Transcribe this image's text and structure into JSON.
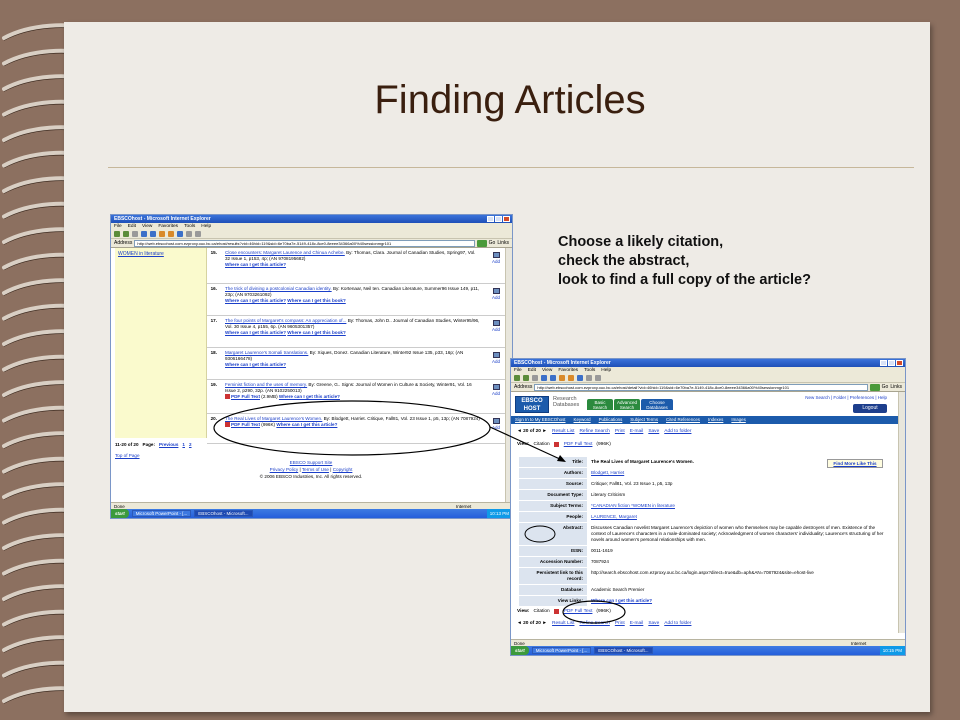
{
  "slide": {
    "title": "Finding Articles",
    "instructions": [
      "Choose a likely citation,",
      "check the abstract,",
      "look to find a full copy of the article?"
    ],
    "colors": {
      "background": "#8c7060",
      "paper": "#eeebe6",
      "title": "#3a1f0f",
      "rule": "#c6b79a",
      "annotation": "#000000"
    }
  },
  "results_window": {
    "title": "EBSCOhost - Microsoft Internet Explorer",
    "menu": [
      "File",
      "Edit",
      "View",
      "Favorites",
      "Tools",
      "Help"
    ],
    "address_label": "Address",
    "address": "http://web.ebscohost.com.ezproxy.ouc.bc.ca/ehost/results?vid=46hid=119&sid=6e70ba7e-5149-418c-8ce0-8eeee34366a00%40sessionmgr101",
    "go": "Go",
    "links_label": "Links",
    "sidebar_link": "WOMEN in literature",
    "results": [
      {
        "num": "15.",
        "title": "Close encounters: Margaret Laurence and Chinua Achebe.",
        "meta": "By: Thomas, Clara. Journal of Canadian Studies, Spring97, Vol. 32 Issue 1, p153, 4p; (AN 9708195682)",
        "where": "Where can I get this article?",
        "add": "Add"
      },
      {
        "num": "16.",
        "title": "The trick of divining a postcolonial Canadian identity.",
        "meta": "By: Kortenaar, Neil ten. Canadian Literature, Summer96 Issue 149, p11, 23p; (AN 9703261092)",
        "where": "Where can I get this article?",
        "where2": "Where can I get this book?",
        "add": "Add"
      },
      {
        "num": "17.",
        "title": "The four points of Margaret's compass: An appreciation of...",
        "meta": "By: Thomas, John D.. Journal of Canadian Studies, Winter95/96, Vol. 30 Issue 4, p155, 6p. (AN 9605301357)",
        "where": "Where can I get this article?",
        "where2": "Where can I get this book?",
        "add": "Add"
      },
      {
        "num": "18.",
        "title": "Margaret Laurence's Somali translations.",
        "meta": "By: Xiques, Donez. Canadian Literature, Winter92 Issue 135, p33, 16p; (AN 9306166478)",
        "where": "Where can I get this article?",
        "add": "Add"
      },
      {
        "num": "19.",
        "title": "Feminist fiction and the uses of memory.",
        "meta": "By: Greene, G.. Signs: Journal of Women in Culture & Society, Winter91, Vol. 16 Issue 2, p290, 32p. (AN 9102250013)",
        "pdf": "PDF Full Text",
        "pdf_size": "(2.9MB)",
        "where": "Where can I get this article?",
        "add": "Add"
      },
      {
        "num": "20.",
        "title": "The Real Lives of Margaret Laurence's Women.",
        "meta": "By: Blodgett, Harriet. Critique, Fall81, Vol. 23 Issue 1, p5, 13p; (AN 7087924)",
        "pdf": "PDF Full Text",
        "pdf_size": "(996K)",
        "where": "Where can I get this article?",
        "add": "Add"
      }
    ],
    "footer": {
      "range": "11-20 of 20",
      "page_label": "Page:",
      "previous": "Previous",
      "pages": [
        "1",
        "2"
      ],
      "top": "Top of Page",
      "support": "EBSCO Support Site",
      "policy": "Privacy Policy",
      "terms": "Terms of Use",
      "copyright_link": "Copyright",
      "copyright": "© 2006 EBSCO Industries, Inc. All rights reserved."
    },
    "status_left": "Done",
    "status_right": "Internet",
    "taskbar": {
      "start": "start",
      "tasks": [
        "Microsoft PowerPoint - [...",
        "EBSCOhost - Microsoft..."
      ],
      "clock": "10:13 PM"
    }
  },
  "record_window": {
    "title": "EBSCOhost - Microsoft Internet Explorer",
    "menu": [
      "File",
      "Edit",
      "View",
      "Favorites",
      "Tools",
      "Help"
    ],
    "address_label": "Address",
    "address": "http://web.ebscohost.com.ezproxy.ouc.bc.ca/ehost/detail?vid=46hid=119&sid=6e70ba7e-5149-418c-8ce0-8eeee34366a00%40sessionmgr101",
    "go": "Go",
    "links_label": "Links",
    "logo_line1": "EBSCO",
    "logo_line2": "HOST",
    "logo_sub": [
      "Research",
      "Databases"
    ],
    "tabs": [
      "Basic Search",
      "Advanced Search",
      "Choose Databases"
    ],
    "top_links": "New Search | Folder | Preferences | Help",
    "logout": "Logout",
    "nav": [
      "Sign In to My EBSCOhost",
      "Keyword",
      "Publications",
      "Subject Terms",
      "Cited References",
      "Indexes",
      "Images"
    ],
    "pager": {
      "count": "◄ 20 of 20 ►",
      "result_list": "Result List",
      "refine": "Refine Search",
      "print": "Print",
      "email": "E-mail",
      "save": "Save",
      "folder": "Add to folder"
    },
    "view": {
      "label": "View:",
      "citation": "Citation",
      "pdf": "PDF Full Text",
      "pdf_size": "(996K)"
    },
    "find_more": "Find More Like This",
    "fields": [
      {
        "label": "Title:",
        "value": "The Real Lives of Margaret Laurence's Women."
      },
      {
        "label": "Authors:",
        "value": "Blodgett, Harriet"
      },
      {
        "label": "Source:",
        "value": "Critique; Fall81, Vol. 23 Issue 1, p5, 13p"
      },
      {
        "label": "Document Type:",
        "value": "Literary Criticism"
      },
      {
        "label": "Subject Terms:",
        "value": "*CANADIAN fiction *WOMEN in literature"
      },
      {
        "label": "People:",
        "value": "LAURENCE, Margaret"
      },
      {
        "label": "Abstract:",
        "value": "Discusses Canadian novelist Margaret Laurence's depiction of women who themselves may be capable destroyers of men. Existence of the context of Laurence's characters in a male-dominated society; Acknowledgment of women characters' individuality; Laurence's structuring of her novels around women's personal relationships with men."
      },
      {
        "label": "ISSN:",
        "value": "0011-1619"
      },
      {
        "label": "Accession Number:",
        "value": "7087924"
      },
      {
        "label": "Persistent link to this record:",
        "value": "http://search.ebscohost.com.ezproxy.ouc.bc.ca/login.aspx?direct=true&db=aph&AN=7087924&site=ehost-live"
      },
      {
        "label": "Database:",
        "value": "Academic Search Premier"
      },
      {
        "label": "View Links:",
        "value": "Where can I get this article?"
      }
    ],
    "status_left": "Done",
    "status_right": "Internet",
    "taskbar": {
      "start": "start",
      "tasks": [
        "Microsoft PowerPoint - [...",
        "EBSCOhost - Microsoft..."
      ],
      "clock": "10:15 PM"
    }
  }
}
